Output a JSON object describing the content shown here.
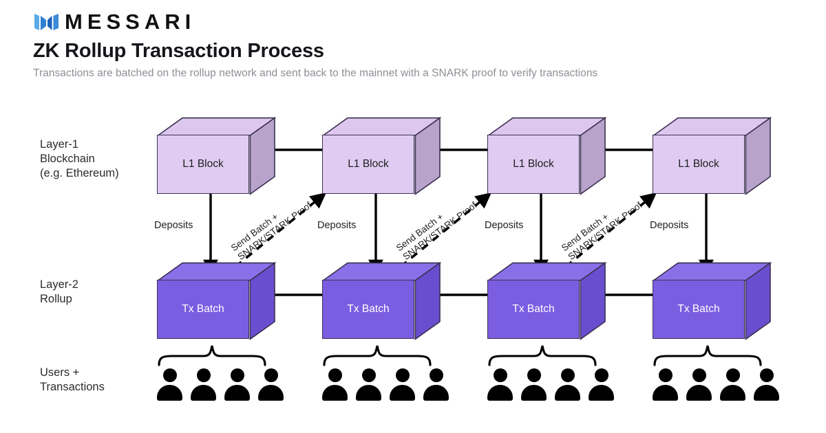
{
  "brand": {
    "name": "MESSARI",
    "logo_icon": "messari-m-logo",
    "logo_colors": [
      "#4a9de0",
      "#2f7fd0",
      "#1f63b8",
      "#3c8ad8"
    ]
  },
  "header": {
    "title": "ZK Rollup Transaction Process",
    "subtitle": "Transactions are batched on the rollup network and sent back to the mainnet with a SNARK proof to verify transactions"
  },
  "rows": {
    "layer1": {
      "label": "Layer-1\nBlockchain\n(e.g. Ethereum)"
    },
    "layer2": {
      "label": "Layer-2\nRollup"
    },
    "users": {
      "label": "Users +\nTransactions"
    }
  },
  "colors": {
    "l1_front": "#e0ccf2",
    "l1_top": "#ddc7ef",
    "l1_side": "#b7a3cb",
    "l2_front": "#7b5de2",
    "l2_top": "#8a70e8",
    "l2_side": "#6a4ed0",
    "outline": "#3b3050",
    "connector": "#000000",
    "subtitle": "#8b8f96",
    "title": "#15161a"
  },
  "diagram": {
    "type": "flow",
    "columns": 4,
    "l1_blocks": [
      {
        "label": "L1 Block"
      },
      {
        "label": "L1 Block"
      },
      {
        "label": "L1 Block"
      },
      {
        "label": "L1 Block"
      }
    ],
    "l2_blocks": [
      {
        "label": "Tx Batch"
      },
      {
        "label": "Tx Batch"
      },
      {
        "label": "Tx Batch"
      },
      {
        "label": "Tx Batch"
      }
    ],
    "deposit_arrows": [
      {
        "label": "Deposits",
        "direction": "l1-to-l2"
      },
      {
        "label": "Deposits",
        "direction": "l1-to-l2"
      },
      {
        "label": "Deposits",
        "direction": "l1-to-l2"
      },
      {
        "label": "Deposits",
        "direction": "l1-to-l2"
      }
    ],
    "proof_arrows": [
      {
        "label": "Send Batch +\nSNARK/STARK Proof",
        "direction": "l2-to-next-l1",
        "style": "dashed"
      },
      {
        "label": "Send Batch +\nSNARK/STARK Proof",
        "direction": "l2-to-next-l1",
        "style": "dashed"
      },
      {
        "label": "Send Batch +\nSNARK/STARK Proof",
        "direction": "l2-to-next-l1",
        "style": "dashed"
      }
    ],
    "user_groups": [
      {
        "brace": true,
        "people": 4
      },
      {
        "brace": true,
        "people": 4
      },
      {
        "brace": true,
        "people": 4
      },
      {
        "brace": true,
        "people": 4
      }
    ]
  }
}
